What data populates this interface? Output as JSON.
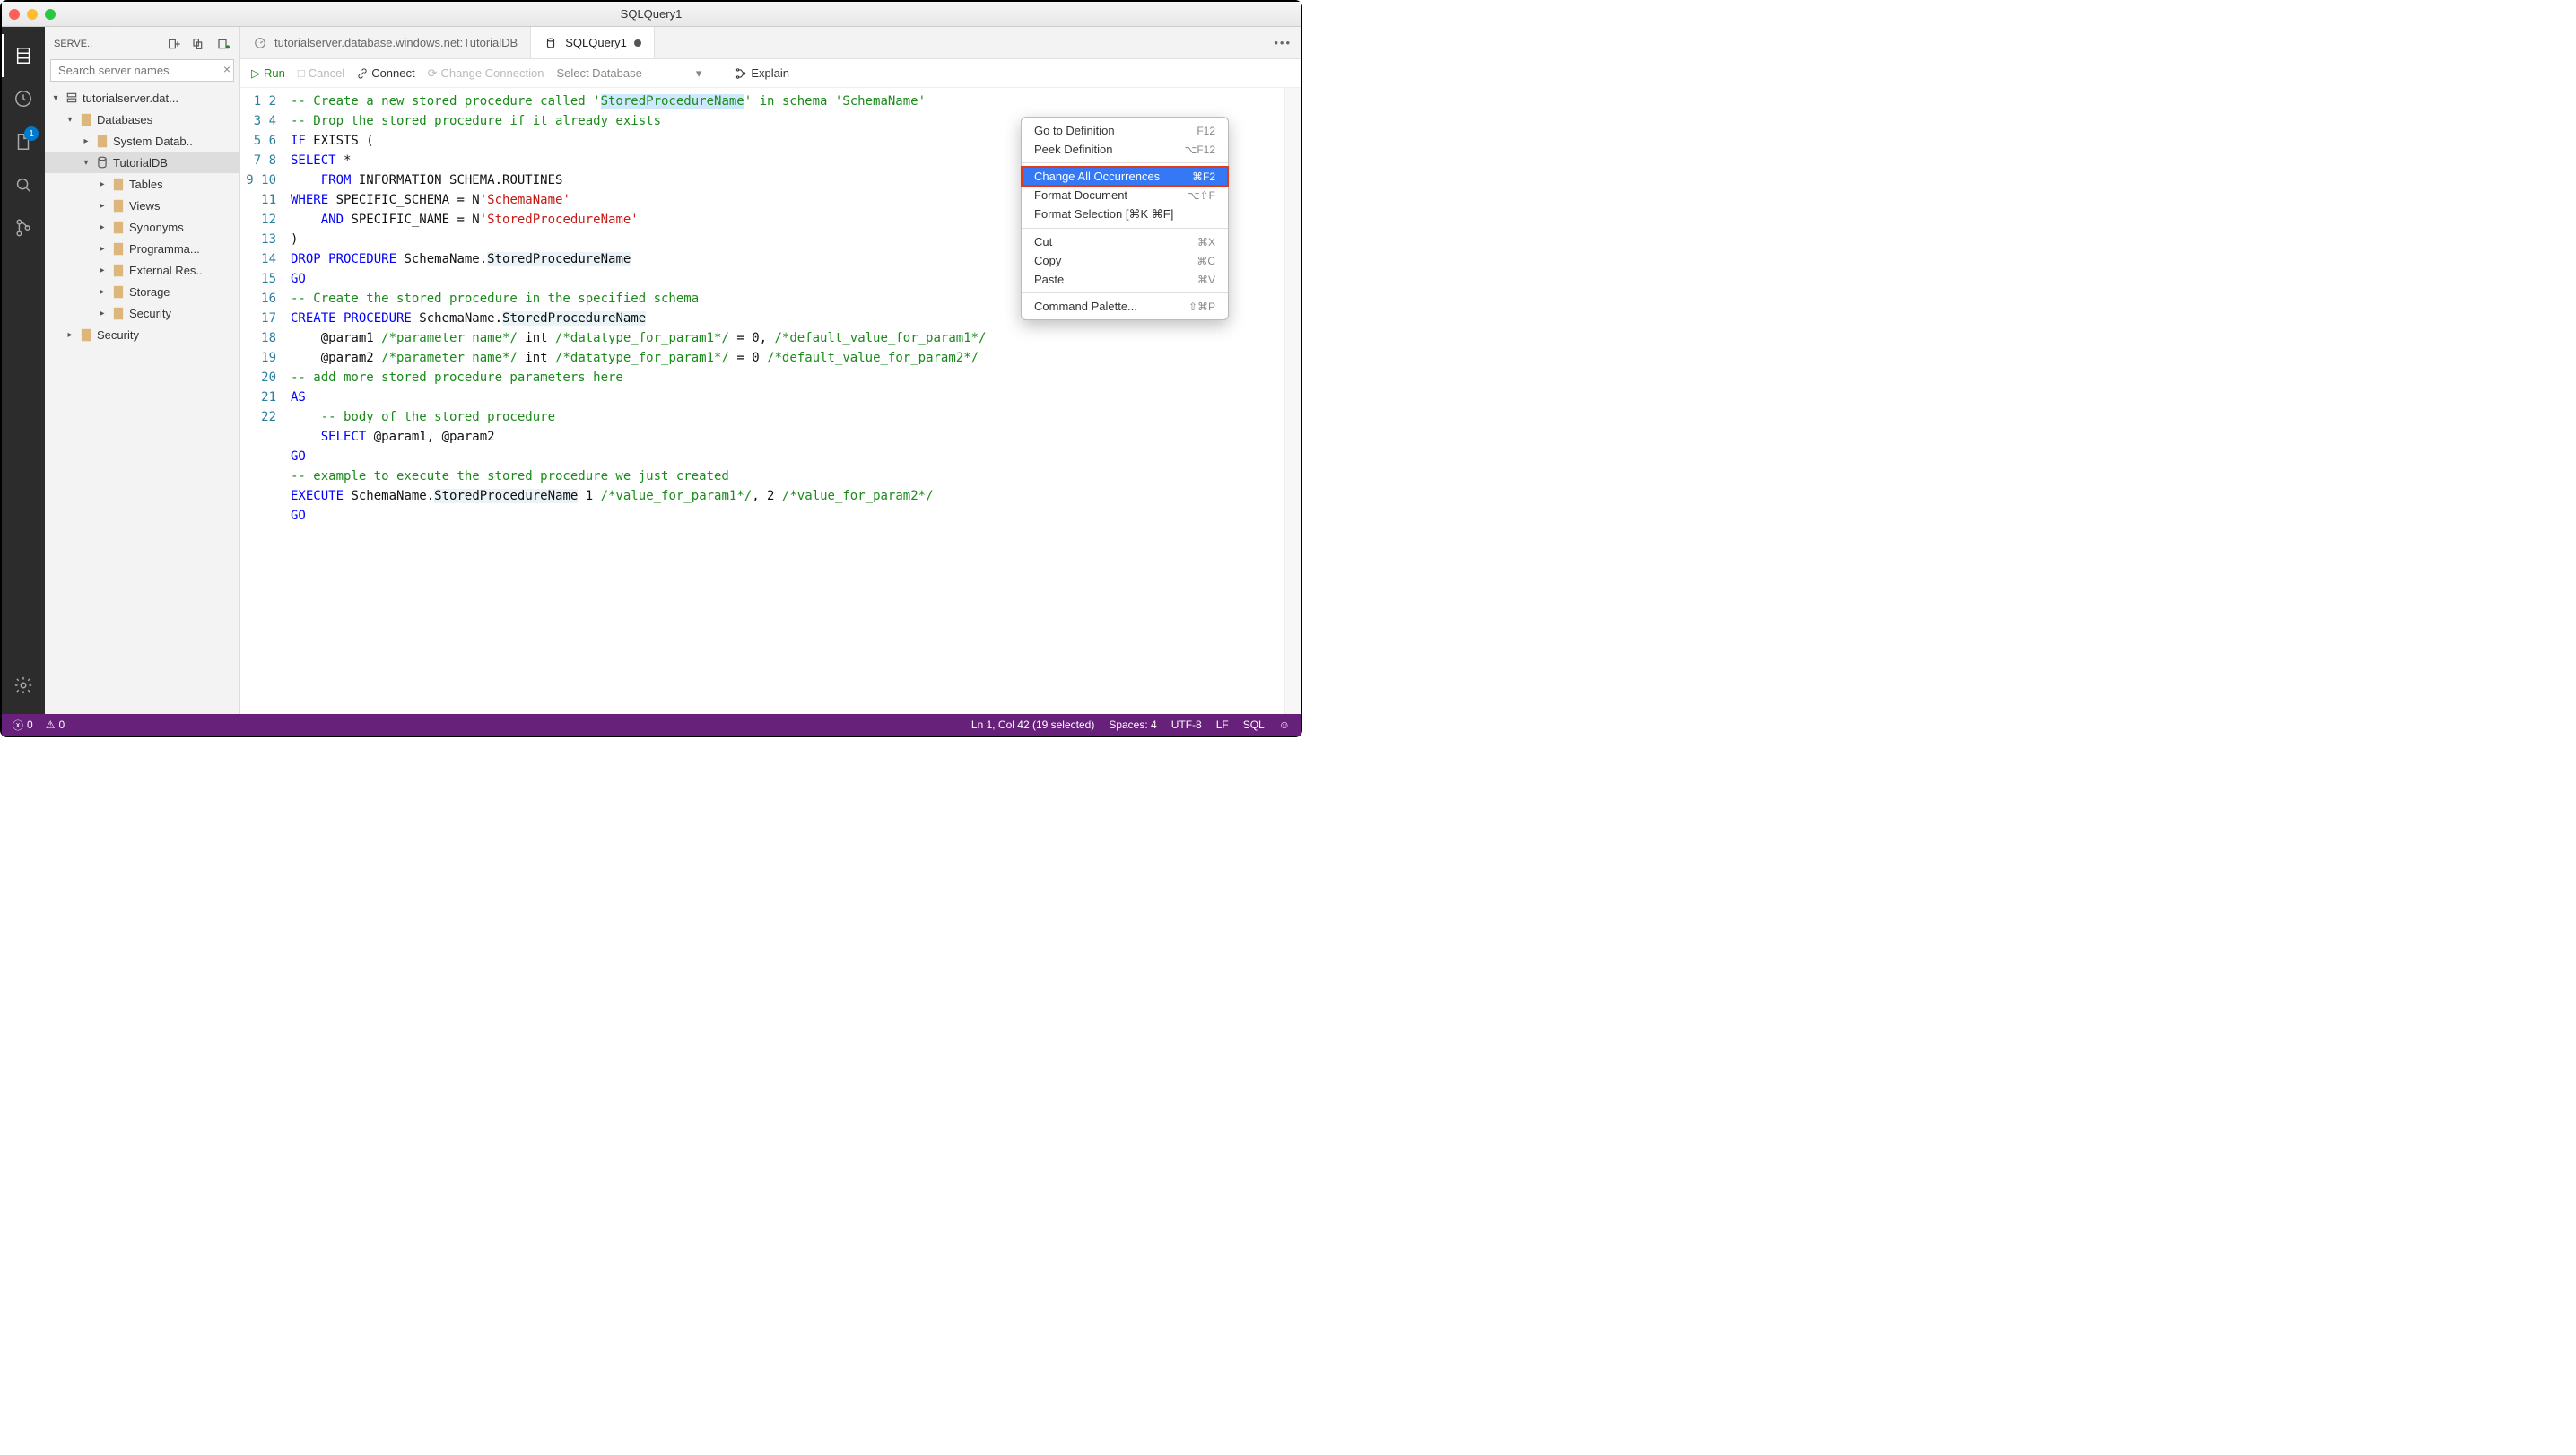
{
  "window": {
    "title": "SQLQuery1"
  },
  "activity": {
    "explorer_badge": "1"
  },
  "side": {
    "head": "SERVE..",
    "search_placeholder": "Search server names",
    "server": "tutorialserver.dat...",
    "databases": "Databases",
    "systemdb": "System Datab..",
    "tutorialdb": "TutorialDB",
    "tables": "Tables",
    "views": "Views",
    "synonyms": "Synonyms",
    "programm": "Programma...",
    "extres": "External Res..",
    "storage": "Storage",
    "security_inner": "Security",
    "security_outer": "Security"
  },
  "tabs": {
    "tab0": "tutorialserver.database.windows.net:TutorialDB",
    "tab1": "SQLQuery1"
  },
  "toolbar": {
    "run": "Run",
    "cancel": "Cancel",
    "connect": "Connect",
    "changeconn": "Change Connection",
    "selectdb": "Select Database",
    "explain": "Explain"
  },
  "code": {
    "ln": [
      "1",
      "2",
      "3",
      "4",
      "5",
      "6",
      "7",
      "8",
      "9",
      "10",
      "11",
      "12",
      "13",
      "14",
      "15",
      "16",
      "17",
      "18",
      "19",
      "20",
      "21",
      "22"
    ],
    "l1a": "-- Create a new stored procedure called '",
    "l1b": "StoredProcedureName",
    "l1c": "' in schema 'SchemaName'",
    "l2": "-- Drop the stored procedure if it already exists",
    "l3a": "IF",
    "l3b": " EXISTS ",
    "l3c": "(",
    "l4a": "SELECT",
    "l4b": " *",
    "l5a": "    FROM",
    "l5b": " INFORMATION_SCHEMA.ROUTINES",
    "l6a": "WHERE",
    "l6b": " SPECIFIC_SCHEMA = N",
    "l6c": "'SchemaName'",
    "l7a": "    AND",
    "l7b": " SPECIFIC_NAME = N",
    "l7c": "'StoredProcedureName'",
    "l8": ")",
    "l9a": "DROP",
    "l9b": " PROCEDURE",
    "l9c": " SchemaName.",
    "l9d": "StoredProcedureName",
    "l10": "GO",
    "l11": "-- Create the stored procedure in the specified schema",
    "l12a": "CREATE",
    "l12b": " PROCEDURE",
    "l12c": " SchemaName.",
    "l12d": "StoredProcedureName",
    "l13a": "    @param1 ",
    "l13b": "/*parameter name*/",
    "l13c": " int ",
    "l13d": "/*datatype_for_param1*/",
    "l13e": " = 0, ",
    "l13f": "/*default_value_for_param1*/",
    "l14a": "    @param2 ",
    "l14b": "/*parameter name*/",
    "l14c": " int ",
    "l14d": "/*datatype_for_param1*/",
    "l14e": " = 0 ",
    "l14f": "/*default_value_for_param2*/",
    "l15": "-- add more stored procedure parameters here",
    "l16": "AS",
    "l17": "    -- body of the stored procedure",
    "l18a": "    SELECT",
    "l18b": " @param1, @param2",
    "l19": "GO",
    "l20": "-- example to execute the stored procedure we just created",
    "l21a": "EXECUTE",
    "l21b": " SchemaName.",
    "l21c": "StoredProcedureName",
    "l21d": " 1 ",
    "l21e": "/*value_for_param1*/",
    "l21f": ", 2 ",
    "l21g": "/*value_for_param2*/",
    "l22": "GO"
  },
  "context": {
    "goto": {
      "label": "Go to Definition",
      "sc": "F12"
    },
    "peek": {
      "label": "Peek Definition",
      "sc": "⌥F12"
    },
    "change": {
      "label": "Change All Occurrences",
      "sc": "⌘F2"
    },
    "formatdoc": {
      "label": "Format Document",
      "sc": "⌥⇧F"
    },
    "formatsel": {
      "label": "Format Selection [⌘K ⌘F]",
      "sc": ""
    },
    "cut": {
      "label": "Cut",
      "sc": "⌘X"
    },
    "copy": {
      "label": "Copy",
      "sc": "⌘C"
    },
    "paste": {
      "label": "Paste",
      "sc": "⌘V"
    },
    "palette": {
      "label": "Command Palette...",
      "sc": "⇧⌘P"
    }
  },
  "status": {
    "errors": "0",
    "warnings": "0",
    "pos": "Ln 1, Col 42 (19 selected)",
    "spaces": "Spaces: 4",
    "enc": "UTF-8",
    "eol": "LF",
    "lang": "SQL"
  }
}
